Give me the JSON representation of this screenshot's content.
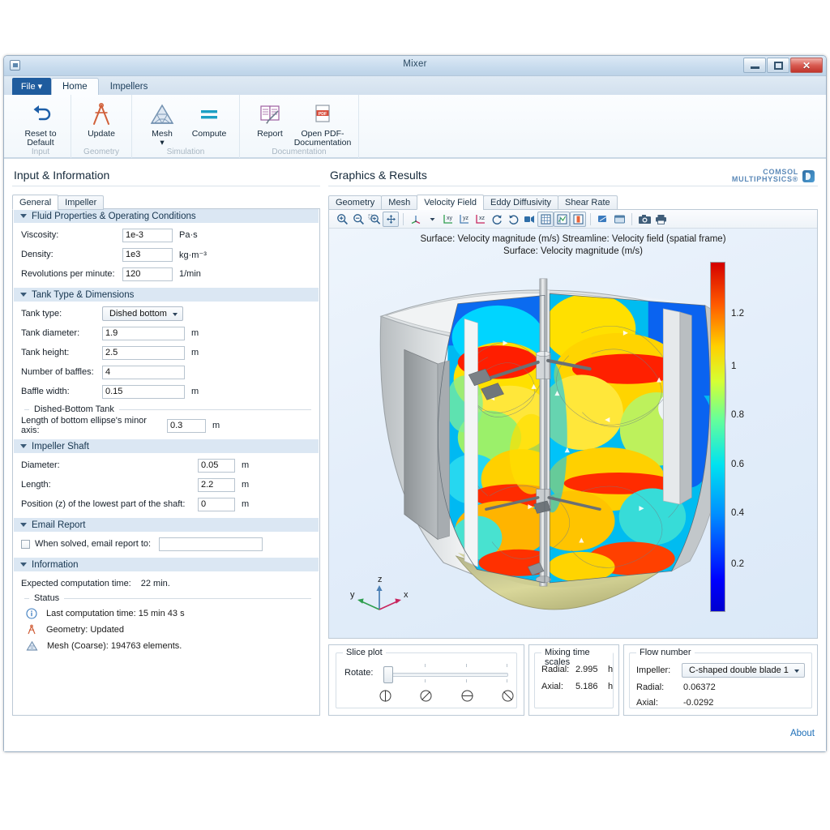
{
  "window": {
    "title": "Mixer",
    "buttons": {
      "minimize": "minimize-button",
      "maximize": "maximize-button",
      "close": "✕"
    }
  },
  "ribbon": {
    "file_tab": "File ▾",
    "tabs": [
      {
        "label": "Home",
        "active": true
      },
      {
        "label": "Impellers",
        "active": false
      }
    ],
    "groups": [
      {
        "label": "Input",
        "buttons": [
          {
            "label": "Reset to\nDefault",
            "label_l1": "Reset to",
            "label_l2": "Default",
            "icon": "undo-arrow-icon"
          }
        ]
      },
      {
        "label": "Geometry",
        "buttons": [
          {
            "label_l1": "Update",
            "label_l2": "",
            "icon": "compass-icon"
          }
        ]
      },
      {
        "label": "Simulation",
        "buttons": [
          {
            "label_l1": "Mesh",
            "label_l2": "▾",
            "icon": "mesh-triangle-icon"
          },
          {
            "label_l1": "Compute",
            "label_l2": "",
            "icon": "equals-icon"
          }
        ]
      },
      {
        "label": "Documentation",
        "buttons": [
          {
            "label_l1": "Report",
            "label_l2": "",
            "icon": "report-icon"
          },
          {
            "label_l1": "Open PDF-",
            "label_l2": "Documentation",
            "icon": "pdf-icon"
          }
        ]
      }
    ]
  },
  "left_panel": {
    "title": "Input & Information",
    "tabs": [
      {
        "label": "General",
        "active": true
      },
      {
        "label": "Impeller",
        "active": false
      }
    ],
    "sections": {
      "fluid": {
        "header": "Fluid Properties & Operating Conditions",
        "rows": [
          {
            "label": "Viscosity:",
            "value": "1e-3",
            "unit": "Pa·s"
          },
          {
            "label": "Density:",
            "value": "1e3",
            "unit": "kg·m⁻³"
          },
          {
            "label": "Revolutions per minute:",
            "value": "120",
            "unit": "1/min"
          }
        ]
      },
      "tank": {
        "header": "Tank Type & Dimensions",
        "tank_type_label": "Tank type:",
        "tank_type_value": "Dished bottom",
        "rows": [
          {
            "label": "Tank diameter:",
            "value": "1.9",
            "unit": "m"
          },
          {
            "label": "Tank height:",
            "value": "2.5",
            "unit": "m"
          },
          {
            "label": "Number of baffles:",
            "value": "4",
            "unit": ""
          },
          {
            "label": "Baffle width:",
            "value": "0.15",
            "unit": "m"
          }
        ],
        "subgroup_label": "Dished-Bottom Tank",
        "ellipse_label": "Length of bottom ellipse's minor axis:",
        "ellipse_value": "0.3",
        "ellipse_unit": "m"
      },
      "shaft": {
        "header": "Impeller Shaft",
        "rows": [
          {
            "label": "Diameter:",
            "value": "0.05",
            "unit": "m"
          },
          {
            "label": "Length:",
            "value": "2.2",
            "unit": "m"
          },
          {
            "label": "Position (z) of the lowest part of the shaft:",
            "value": "0",
            "unit": "m"
          }
        ]
      },
      "email": {
        "header": "Email Report",
        "checkbox_label": "When solved, email report to:",
        "checked": false,
        "email_value": "",
        "email_placeholder": ""
      },
      "information": {
        "header": "Information",
        "expected_label": "Expected computation time:",
        "expected_value": "22 min.",
        "status_label": "Status",
        "status_items": [
          {
            "icon": "info-icon",
            "text": "Last computation time: 15 min 43 s"
          },
          {
            "icon": "geometry-compass-icon",
            "text": "Geometry: Updated"
          },
          {
            "icon": "mesh-triangle-icon",
            "text": "Mesh (Coarse): 194763 elements."
          }
        ]
      }
    }
  },
  "right_panel": {
    "title": "Graphics & Results",
    "logo_line1": "COMSOL",
    "logo_line2": "MULTIPHYSICS®",
    "tabs": [
      {
        "label": "Geometry",
        "active": false
      },
      {
        "label": "Mesh",
        "active": false
      },
      {
        "label": "Velocity Field",
        "active": true
      },
      {
        "label": "Eddy Diffusivity",
        "active": false
      },
      {
        "label": "Shear Rate",
        "active": false
      }
    ],
    "toolbar_icons": [
      "zoom-in-icon",
      "zoom-out-icon",
      "zoom-box-icon",
      "zoom-extents-icon",
      "orientation-axis-icon",
      "orientation-dropdown-icon",
      "view-xy-icon",
      "view-yz-icon",
      "view-xz-icon",
      "rotate-cw-icon",
      "rotate-ccw-icon",
      "scene-light-icon",
      "grid-icon",
      "plot-data-icon",
      "color-legend-icon",
      "transparency-icon",
      "window-icon",
      "snapshot-camera-icon",
      "print-icon"
    ],
    "axis_triad": {
      "x": "x",
      "y": "y",
      "z": "z"
    },
    "slice_plot": {
      "group_label": "Slice plot",
      "rotate_label": "Rotate:",
      "slider_value": 0,
      "slider_min": 0,
      "slider_max": 100,
      "angle_icons": [
        "slice-angle-90-icon",
        "slice-angle-45-icon",
        "slice-angle-0-icon",
        "slice-angle-135-icon"
      ]
    },
    "mixing_time": {
      "group_label": "Mixing time scales",
      "rows": [
        {
          "label": "Radial:",
          "value": "2.995",
          "unit": "h"
        },
        {
          "label": "Axial:",
          "value": "5.186",
          "unit": "h"
        }
      ]
    },
    "flow_number": {
      "group_label": "Flow number",
      "impeller_label": "Impeller:",
      "impeller_value": "C-shaped double blade 1",
      "rows": [
        {
          "label": "Radial:",
          "value": "0.06372"
        },
        {
          "label": "Axial:",
          "value": "-0.0292"
        }
      ]
    }
  },
  "footer": {
    "about": "About"
  },
  "chart_data": {
    "type": "heatmap",
    "title_line1": "Surface: Velocity magnitude (m/s)  Streamline: Velocity field (spatial frame)",
    "title_line2": "Surface: Velocity magnitude (m/s)",
    "colormap": "jet",
    "colorbar": {
      "ticks": [
        "1.2",
        "1",
        "0.8",
        "0.6",
        "0.4",
        "0.2"
      ],
      "tick_values": [
        1.2,
        1.0,
        0.8,
        0.6,
        0.4,
        0.2
      ],
      "min": 0.0,
      "max": 1.3,
      "unit": "m/s",
      "position": "right"
    },
    "colors": {
      "low": "#0000ff",
      "mid_low": "#00d7ff",
      "mid": "#7cff78",
      "mid_high": "#ffd400",
      "high": "#ff0000",
      "tank_body": "#c8ccce",
      "tank_bottom": "#c9c77a",
      "background": "#e6eff9"
    }
  }
}
